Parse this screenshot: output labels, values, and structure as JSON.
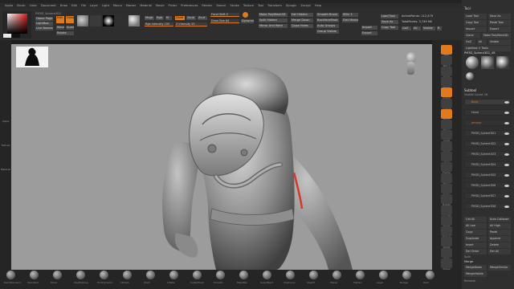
{
  "menubar": {
    "items": [
      "Alpha",
      "Brush",
      "Color",
      "Document",
      "Draw",
      "Edit",
      "File",
      "Layer",
      "Light",
      "Macro",
      "Marker",
      "Material",
      "Movie",
      "Picker",
      "Preferences",
      "Render",
      "Stencil",
      "Stroke",
      "Texture",
      "Tool",
      "Transform",
      "Zplugin",
      "Zscript",
      "Help"
    ]
  },
  "topbar": {
    "projection_label": "PM3D_Sphere3D1",
    "home_button": "Home Page",
    "lightbox_button": "LightBox",
    "live_boolean": "Live Boolean",
    "edit_button": "Edit",
    "draw_button": "Draw",
    "move_button": "Move",
    "scale_button": "Scale",
    "rotate_button": "Rotate",
    "mrgb_button": "Mrgb",
    "rgb_button": "Rgb",
    "m_button": "M",
    "zadd_button": "Zadd",
    "zsub_button": "Zsub",
    "zcut_button": "Zcut",
    "focal_shift": "Focal Shift  0",
    "draw_size": "Draw Size  64",
    "dynamic_button": "Dynamic",
    "rgb_intensity": "Rgb Intensity 100",
    "z_intensity": "Z Intensity 25",
    "active_points": "ActivePoints: 112,479",
    "total_points": "TotalPoints: 3,749 Mil",
    "load_tool": "Load Tool",
    "save_as": "Save As",
    "copy_tool": "Copy Tool",
    "import_button": "Import",
    "export_button": "Export",
    "clone_button": "Clone",
    "goz_button": "GoZ",
    "all_button": "All",
    "visible_button": "Visible",
    "r_button": "R",
    "make_polymesh": "Make PolyMesh3D",
    "dist_masked": "Dist Masked",
    "spilt_hidden": "Split Hidden",
    "mirror_weld": "Mirror And Weld",
    "merge_down": "Merge Down",
    "del_hidden": "Del Hidden",
    "close_holes": "Close Holes",
    "smooth_brush": "Smooth Brush",
    "backface_mask": "BackfaceMask",
    "auto_groups": "Auto Groups",
    "group_visible": "Group Visible",
    "sdiv": "SDiv 1"
  },
  "canvas": {
    "bg_color": "#9c9c9c"
  },
  "right_tray": {
    "title": "Tool",
    "load_tool": "Load Tool",
    "save_as": "Save As",
    "copy_tool": "Copy Tool",
    "paste_tool": "Paste Tool",
    "import_btn": "Import",
    "export_btn": "Export",
    "clone_btn": "Clone",
    "make_polymesh": "Make PolyMesh3D",
    "goz": "GoZ",
    "all": "All",
    "visible": "Visible",
    "lightbox_tools": "Lightbox > Tools",
    "current_tool": "PM3D_Sphere3D1_48",
    "subtool_title": "Subtool",
    "visible_count": "Visible Count 16",
    "subtools": [
      "Body",
      "Head",
      "armour",
      "PM3D_Sphere3D1",
      "PM3D_Sphere3D2",
      "PM3D_Sphere3D3",
      "PM3D_Sphere3D4",
      "PM3D_Sphere3D5",
      "PM3D_Sphere3D6",
      "PM3D_Sphere3D7",
      "PM3D_Sphere3D8"
    ],
    "list_all": "List All",
    "auto_collapse": "Auto Collapse",
    "all_low": "All Low",
    "all_high": "All High",
    "copy": "Copy",
    "paste": "Paste",
    "duplicate": "Duplicate",
    "append": "Append",
    "insert": "Insert",
    "delete": "Delete",
    "del_other": "Del Other",
    "del_all": "Del All",
    "split": "Split",
    "merge": "Merge",
    "merge_down": "MergeDown",
    "merge_similar": "MergeSimilar",
    "merge_visible": "MergeVisible",
    "remesh": "Remesh"
  },
  "right_shelf": [
    "BPR",
    "SPix 3",
    "Scroll",
    "Zoom",
    "Actual",
    "AAHalf",
    "Persp",
    "Floor",
    "Local",
    "LSym",
    "Xyz",
    "Frame",
    "Move",
    "Scale",
    "Rotate",
    "Line Fill",
    "PolyF",
    "Transp",
    "Ghost",
    "Solo",
    "Xpose"
  ],
  "left_shelf": [
    "Alpha",
    "Texture",
    "Material"
  ],
  "bottom_shelf": [
    "DamStandard",
    "Standard",
    "Move",
    "ClayBuildup",
    "TrimDynamic",
    "hPolish",
    "Pinch",
    "Inflate",
    "SnakeHook",
    "Smooth",
    "MaskPen",
    "SelectRect",
    "ClipCurve",
    "Slash3",
    "Planar",
    "Flatten",
    "Layer",
    "Nudge",
    "Dam"
  ]
}
